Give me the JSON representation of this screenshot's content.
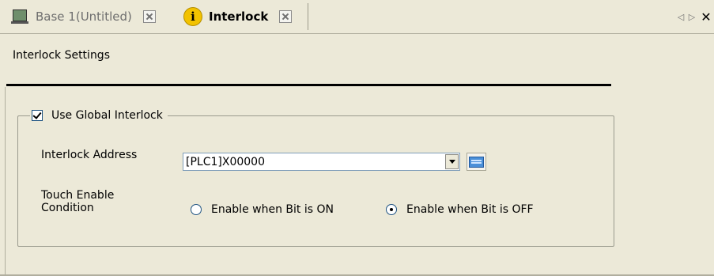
{
  "tabs": [
    {
      "label": "Base 1(Untitled)",
      "icon": "monitor-icon",
      "active": false
    },
    {
      "label": "Interlock",
      "icon": "info-icon",
      "active": true
    }
  ],
  "nav": {
    "prev": "◁",
    "next": "▷",
    "close": "✕"
  },
  "section": {
    "title": "Interlock Settings"
  },
  "group": {
    "checkbox_label": "Use Global Interlock",
    "checked": true,
    "address_label": "Interlock Address",
    "address_value": "[PLC1]X00000",
    "touch_label": "Touch Enable Condition",
    "radio_options": [
      {
        "label": "Enable when Bit is ON",
        "selected": false
      },
      {
        "label": "Enable when Bit is OFF",
        "selected": true
      }
    ]
  },
  "colors": {
    "background": "#ece9d8",
    "accent": "#1c5180"
  }
}
